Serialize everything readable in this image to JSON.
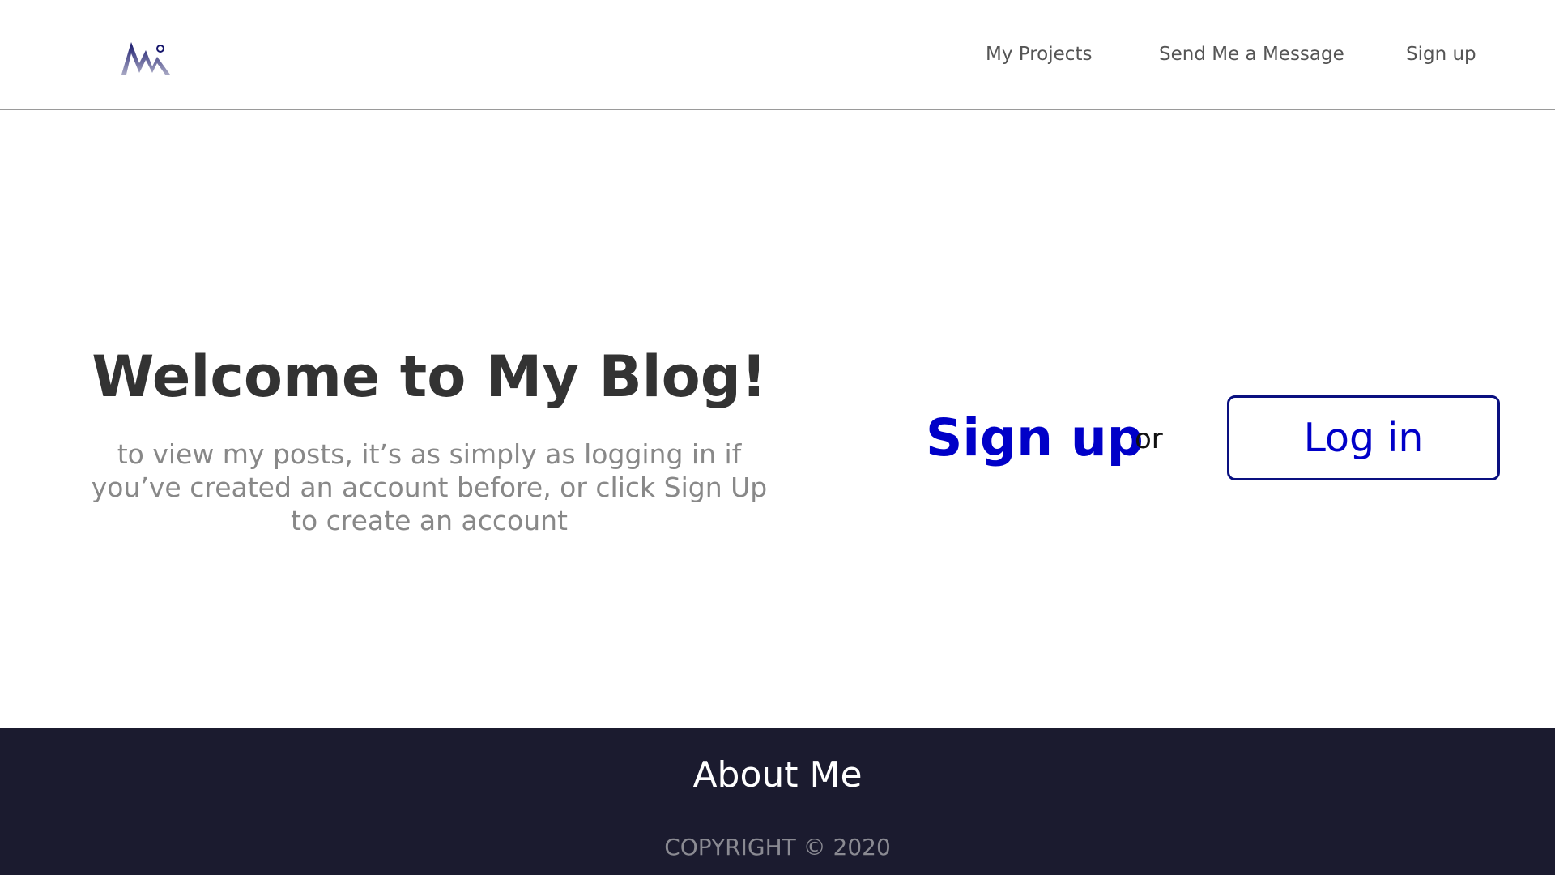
{
  "header": {
    "logo_icon": "mountain-logo-icon",
    "nav": {
      "projects": "My Projects",
      "message": "Send Me a Message",
      "signup": "Sign up"
    }
  },
  "hero": {
    "title": "Welcome to My Blog!",
    "subtitle": "to view my posts, it’s as simply as logging in if you’ve created an account before, or click Sign Up to create an account",
    "signup_label": "Sign up",
    "or_label": "or",
    "login_label": "Log in"
  },
  "footer": {
    "about_label": "About Me",
    "copyright": "COPYRIGHT © 2020"
  },
  "colors": {
    "accent": "#0000c8",
    "login_border": "#0a1080",
    "footer_bg": "#1b1b2f",
    "title": "#333333",
    "subtitle": "#888888"
  }
}
